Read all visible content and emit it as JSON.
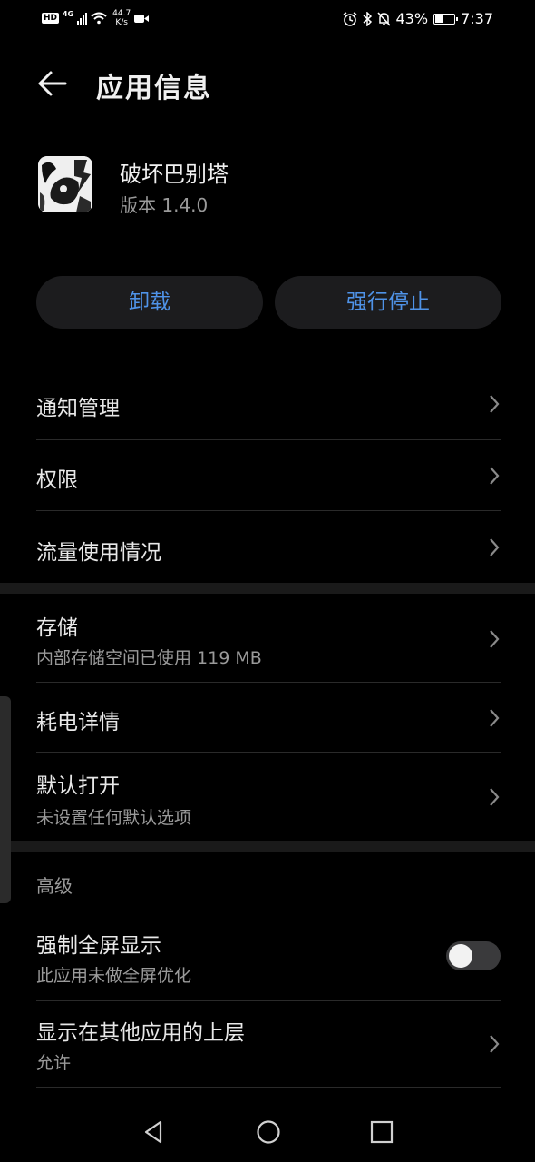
{
  "status_bar": {
    "hd": "HD",
    "signal_type": "4G",
    "speed_value": "44.7",
    "speed_unit": "K/s",
    "battery_text": "43%",
    "battery_level": 0.43,
    "time": "7:37",
    "icons": [
      "signal-icon",
      "wifi-icon",
      "video-icon",
      "alarm-icon",
      "bluetooth-icon",
      "mute-icon",
      "battery-icon"
    ]
  },
  "header": {
    "title": "应用信息",
    "back_icon": "arrow-left"
  },
  "app": {
    "name": "破坏巴别塔",
    "version": "版本 1.4.0"
  },
  "actions": {
    "uninstall": "卸载",
    "force_stop": "强行停止"
  },
  "settings": [
    {
      "title": "通知管理"
    },
    {
      "title": "权限"
    },
    {
      "title": "流量使用情况"
    },
    {
      "title": "存储",
      "subtitle": "内部存储空间已使用 119 MB"
    },
    {
      "title": "耗电详情"
    },
    {
      "title": "默认打开",
      "subtitle": "未设置任何默认选项"
    }
  ],
  "advanced": {
    "label": "高级",
    "fullscreen": {
      "title": "强制全屏显示",
      "subtitle": "此应用未做全屏优化",
      "enabled": false
    },
    "overlay": {
      "title": "显示在其他应用的上层",
      "subtitle": "允许"
    }
  },
  "nav": {
    "icons": [
      "back-triangle",
      "home-circle",
      "recents-square"
    ]
  },
  "colors": {
    "background": "#000000",
    "accent": "#4f93e8",
    "button_bg": "#1c1c1e",
    "secondary_text": "#9a9a9a"
  }
}
